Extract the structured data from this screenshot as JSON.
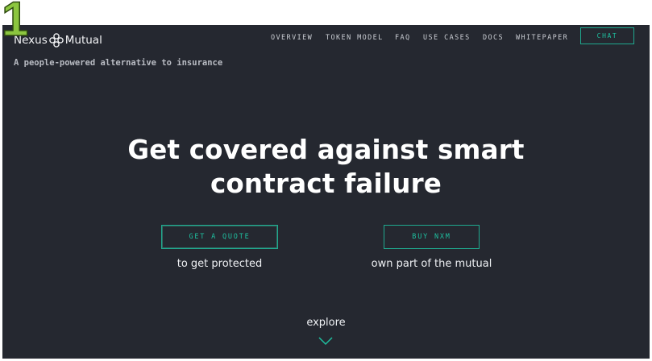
{
  "step_badge": "1",
  "brand": {
    "name_left": "Nexus",
    "name_right": "Mutual",
    "logo_icon": "nexus-mutual-logo-icon"
  },
  "nav": {
    "items": [
      "OVERVIEW",
      "TOKEN MODEL",
      "FAQ",
      "USE CASES",
      "DOCS",
      "WHITEPAPER"
    ],
    "chat_label": "CHAT"
  },
  "tagline": "A people-powered alternative to insurance",
  "hero": {
    "line1": "Get covered against smart",
    "line2": "contract failure"
  },
  "cta": {
    "quote": {
      "label": "GET A QUOTE",
      "caption": "to get protected"
    },
    "buy": {
      "label": "BUY NXM",
      "caption": "own part of the mutual"
    }
  },
  "explore": {
    "label": "explore",
    "icon": "chevron-down-icon"
  },
  "colors": {
    "background": "#252830",
    "accent": "#1fbf9f",
    "badge": "#8cc63f",
    "text": "#ffffff"
  }
}
